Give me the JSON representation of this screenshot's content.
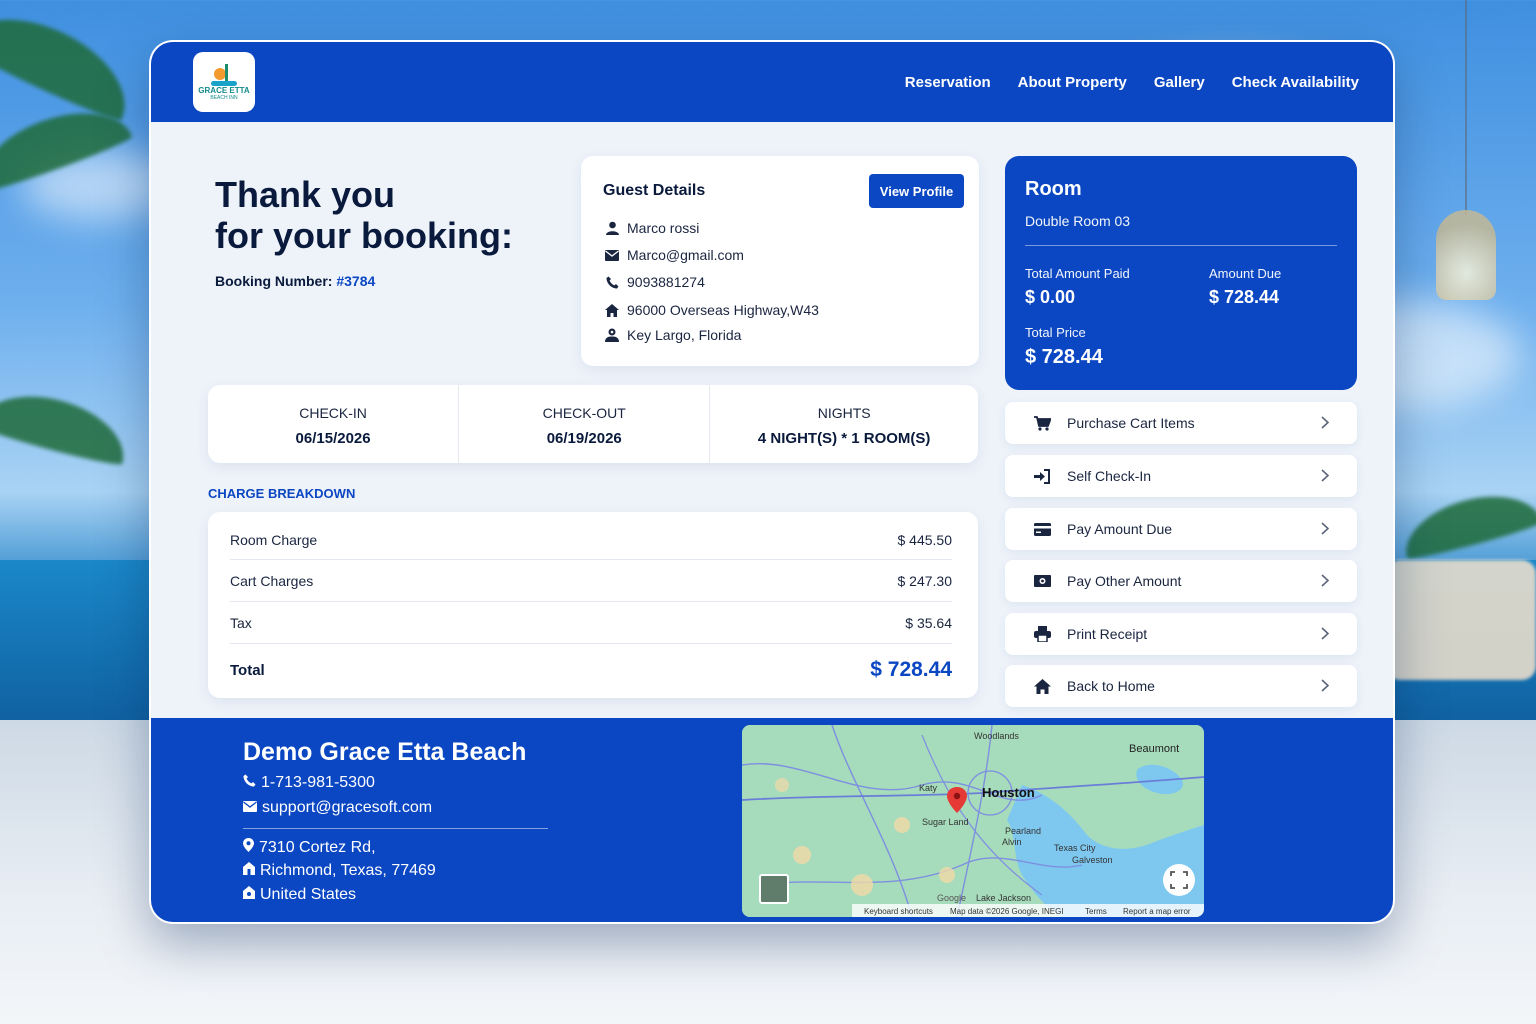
{
  "header": {
    "logo_text": "GRACE ETTA",
    "logo_sub": "BEACH INN",
    "nav": [
      "Reservation",
      "About Property",
      "Gallery",
      "Check Availability"
    ]
  },
  "thanks": {
    "line1": "Thank you",
    "line2": "for your booking:",
    "booking_label": "Booking Number:",
    "booking_number": "#3784"
  },
  "guest": {
    "title": "Guest Details",
    "view_profile": "View Profile",
    "name": "Marco rossi",
    "email": "Marco@gmail.com",
    "phone": "9093881274",
    "address": "96000 Overseas Highway,W43",
    "city": "Key Largo, Florida"
  },
  "room": {
    "title": "Room",
    "name": "Double Room 03",
    "paid_label": "Total Amount Paid",
    "paid_value": "$ 0.00",
    "due_label": "Amount Due",
    "due_value": "$ 728.44",
    "total_label": "Total Price",
    "total_value": "$ 728.44"
  },
  "stay": {
    "checkin_label": "CHECK-IN",
    "checkin_value": "06/15/2026",
    "checkout_label": "CHECK-OUT",
    "checkout_value": "06/19/2026",
    "nights_label": "NIGHTS",
    "nights_value": "4 NIGHT(S) * 1 ROOM(S)"
  },
  "charges": {
    "title": "CHARGE BREAKDOWN",
    "rows": [
      {
        "label": "Room Charge",
        "value": "$ 445.50"
      },
      {
        "label": "Cart Charges",
        "value": "$ 247.30"
      },
      {
        "label": "Tax",
        "value": "$ 35.64"
      }
    ],
    "total_label": "Total",
    "total_value": "$ 728.44"
  },
  "actions": [
    {
      "label": "Purchase Cart Items",
      "icon": "cart-icon"
    },
    {
      "label": "Self Check-In",
      "icon": "sign-in-icon"
    },
    {
      "label": "Pay Amount Due",
      "icon": "credit-card-icon"
    },
    {
      "label": "Pay Other Amount",
      "icon": "money-icon"
    },
    {
      "label": "Print Receipt",
      "icon": "printer-icon"
    },
    {
      "label": "Back to Home",
      "icon": "home-icon"
    }
  ],
  "footer": {
    "name": "Demo Grace Etta Beach",
    "phone": "1-713-981-5300",
    "email": "support@gracesoft.com",
    "street": "7310 Cortez Rd,",
    "city": "Richmond, Texas, 77469",
    "country": "United States"
  },
  "map": {
    "labels": {
      "houston": "Houston",
      "beaumont": "Beaumont",
      "woodlands": "Woodlands",
      "katy": "Katy",
      "sugarland": "Sugar Land",
      "pearland": "Pearland",
      "texas_city": "Texas City",
      "galveston": "Galveston",
      "alvin": "Alvin",
      "lake_jackson": "Lake Jackson"
    },
    "google": "Google",
    "keyboard": "Keyboard shortcuts",
    "mapdata": "Map data ©2026 Google, INEGI",
    "terms": "Terms",
    "report": "Report a map error"
  },
  "colors": {
    "primary": "#0b47c2",
    "text_dark": "#0a1a3c",
    "card_bg": "#eef3fa"
  }
}
